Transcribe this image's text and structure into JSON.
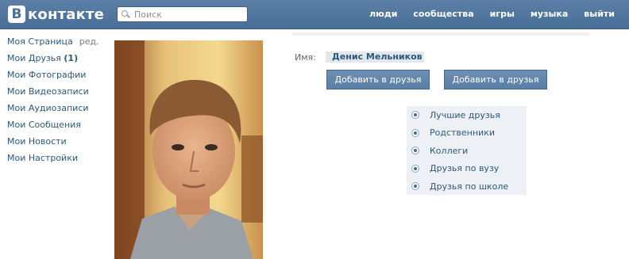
{
  "header": {
    "logo_letter": "B",
    "logo_text": "контакте",
    "search_placeholder": "Поиск",
    "nav": [
      "люди",
      "сообщества",
      "игры",
      "музыка",
      "выйти"
    ]
  },
  "sidebar": {
    "items": [
      {
        "label": "Моя Страница",
        "extra": "ред."
      },
      {
        "label": "Мои Друзья",
        "count": "(1)"
      },
      {
        "label": "Мои Фотографии"
      },
      {
        "label": "Мои Видеозаписи"
      },
      {
        "label": "Мои Аудиозаписи"
      },
      {
        "label": "Мои Сообщения"
      },
      {
        "label": "Мои Новости"
      },
      {
        "label": "Мои Настройки"
      }
    ]
  },
  "profile": {
    "name_label": "Имя:",
    "name_value": "Денис Мельников",
    "buttons": [
      "Добавить в друзья",
      "Добавить в друзья"
    ],
    "friend_lists": [
      "Лучшие друзья",
      "Родственники",
      "Коллеги",
      "Друзья по вузу",
      "Друзья по школе"
    ]
  },
  "colors": {
    "header": "#4a6f98",
    "link": "#2b587a",
    "button": "#5a7ea5",
    "panel": "#edf1f5"
  }
}
